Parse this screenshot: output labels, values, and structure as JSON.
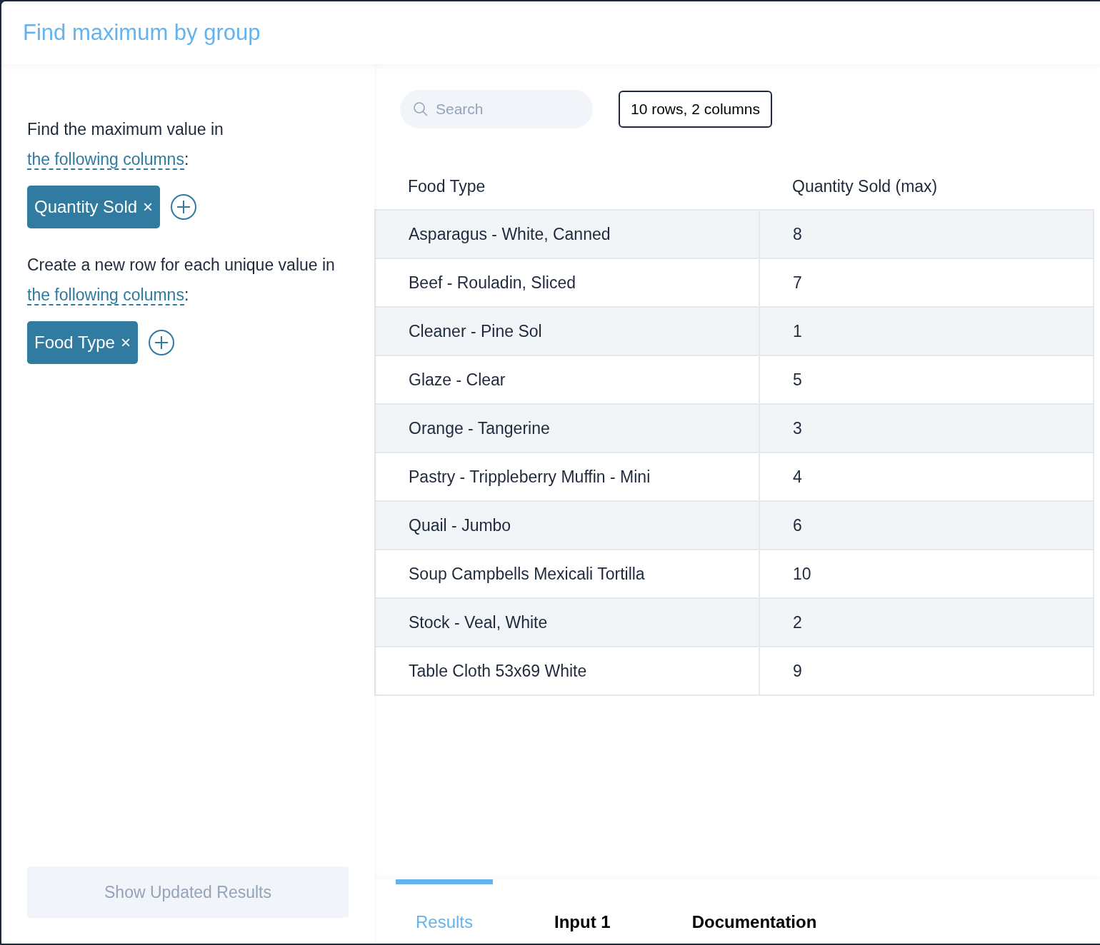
{
  "title": "Find maximum by group",
  "sections": [
    {
      "text_before": "Find the maximum value in ",
      "link": "the following columns",
      "text_after": ":",
      "chips": [
        "Quantity Sold"
      ],
      "chip_remove": "×"
    },
    {
      "text_before": "Create a new row for each unique value in ",
      "link": "the following columns",
      "text_after": ":",
      "chips": [
        "Food Type"
      ],
      "chip_remove": "×"
    }
  ],
  "update_button": {
    "label": "Show Updated Results",
    "disabled": true
  },
  "search": {
    "placeholder": "Search"
  },
  "summary": "10 rows, 2 columns",
  "table": {
    "columns": [
      "Food Type",
      "Quantity Sold (max)"
    ],
    "rows": [
      [
        "Asparagus - White, Canned",
        "8"
      ],
      [
        "Beef - Rouladin, Sliced",
        "7"
      ],
      [
        "Cleaner - Pine Sol",
        "1"
      ],
      [
        "Glaze - Clear",
        "5"
      ],
      [
        "Orange - Tangerine",
        "3"
      ],
      [
        "Pastry - Trippleberry Muffin - Mini",
        "4"
      ],
      [
        "Quail - Jumbo",
        "6"
      ],
      [
        "Soup Campbells Mexicali Tortilla",
        "10"
      ],
      [
        "Stock - Veal, White",
        "2"
      ],
      [
        "Table Cloth 53x69 White",
        "9"
      ]
    ]
  },
  "tabs": [
    {
      "label": "Results",
      "selected": true
    },
    {
      "label": "Input 1",
      "selected": false
    },
    {
      "label": "Documentation",
      "selected": false
    }
  ]
}
